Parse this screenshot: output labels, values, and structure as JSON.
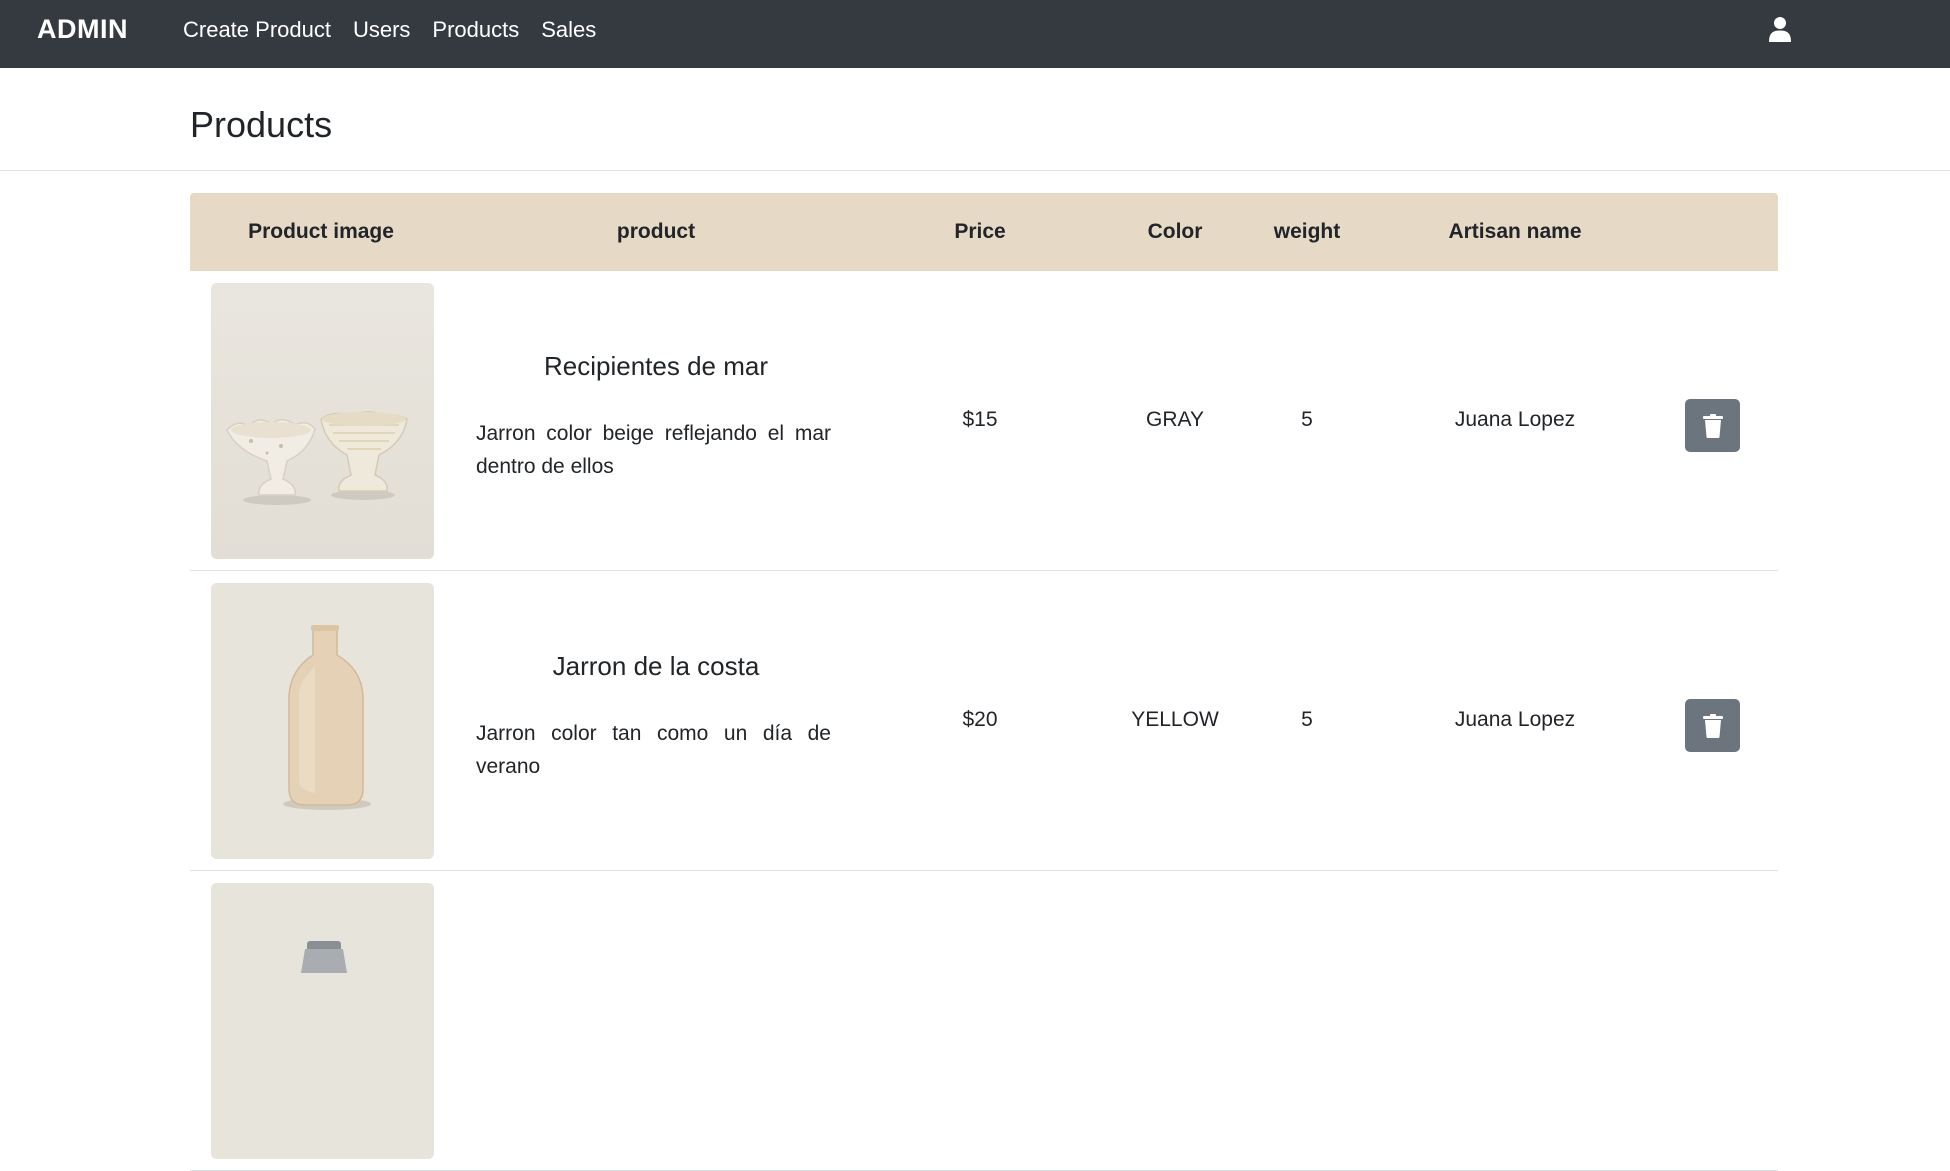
{
  "navbar": {
    "brand": "ADMIN",
    "links": [
      "Create Product",
      "Users",
      "Products",
      "Sales"
    ],
    "user_icon": "user-icon"
  },
  "page": {
    "title": "Products"
  },
  "table": {
    "headers": [
      "Product image",
      "product",
      "Price",
      "Color",
      "weight",
      "Artisan name"
    ],
    "rows": [
      {
        "name": "Recipientes de mar",
        "description": "Jarron color beige reflejando el mar dentro de ellos",
        "price": "$15",
        "color": "GRAY",
        "weight": "5",
        "artisan": "Juana Lopez",
        "image": "two-ceramic-bowls"
      },
      {
        "name": "Jarron de la costa",
        "description": "Jarron color tan como un día de verano",
        "price": "$20",
        "color": "YELLOW",
        "weight": "5",
        "artisan": "Juana Lopez",
        "image": "beige-ceramic-bottle"
      },
      {
        "image": "ceramic-vase-partial"
      }
    ],
    "delete_icon": "trash-icon"
  },
  "colors": {
    "navbar_bg": "#343a40",
    "table_header_bg": "#e6d9c6",
    "delete_button": "#6c757d"
  }
}
